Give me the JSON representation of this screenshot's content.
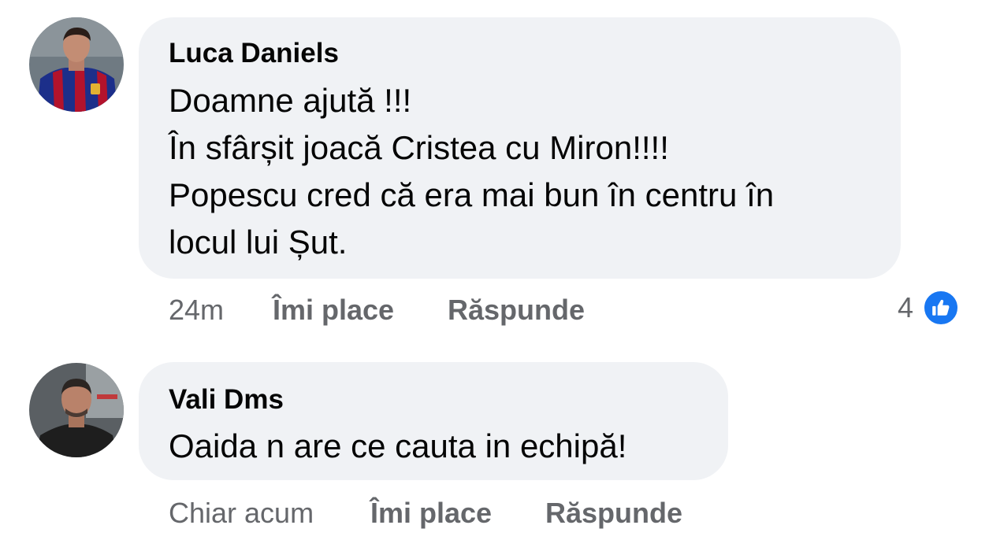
{
  "comments": [
    {
      "author": "Luca Daniels",
      "lines": [
        "Doamne  ajută !!!",
        "În sfârșit joacă Cristea cu Miron!!!!",
        "Popescu cred că era mai bun în centru în",
        "locul lui Șut."
      ],
      "timestamp": "24m",
      "like_label": "Îmi place",
      "reply_label": "Răspunde",
      "reaction_count": "4",
      "reaction_icon": "like-icon",
      "avatar_icon": "avatar-icon"
    },
    {
      "author": "Vali Dms",
      "lines": [
        "Oaida n are ce cauta in echipă!"
      ],
      "timestamp": "Chiar acum",
      "like_label": "Îmi place",
      "reply_label": "Răspunde",
      "avatar_icon": "avatar-icon"
    }
  ],
  "colors": {
    "bubble": "#f0f2f5",
    "text": "#050505",
    "secondary": "#65676b",
    "like_blue": "#1877f2"
  }
}
